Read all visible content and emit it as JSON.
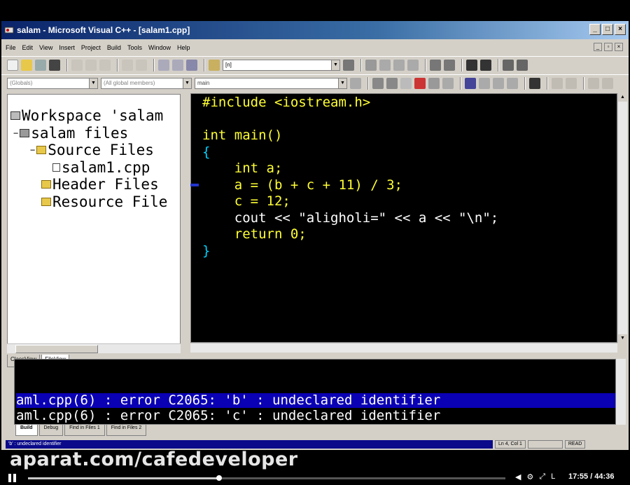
{
  "window": {
    "title": "salam - Microsoft Visual C++ - [salam1.cpp]",
    "buttons": [
      "_",
      "□",
      "×"
    ]
  },
  "menu": [
    "File",
    "Edit",
    "View",
    "Insert",
    "Project",
    "Build",
    "Tools",
    "Window",
    "Help"
  ],
  "toolbar": {
    "find_combo": "[n]",
    "class_combo": "(Globals)",
    "members_combo": "(All global members)",
    "function_combo": "main"
  },
  "workspace": {
    "tree": [
      {
        "label": "Workspace 'salam",
        "icon": "workspace-icon"
      },
      {
        "label": "salam files",
        "icon": "project-icon"
      },
      {
        "label": "Source Files",
        "icon": "folder-icon"
      },
      {
        "label": "salam1.cpp",
        "icon": "file-icon"
      },
      {
        "label": "Header Files",
        "icon": "folder-icon"
      },
      {
        "label": "Resource File",
        "icon": "folder-icon"
      }
    ],
    "tabs": [
      "ClassView",
      "FileView"
    ]
  },
  "code_lines": [
    "#include <iostream.h>",
    "",
    "int main()",
    "{",
    "    int a;",
    "    a = (b + c + 11) / 3;",
    "    c = 12;",
    "    cout << \"aligholi=\" << a << \"\\n\";",
    "    return 0;",
    "}"
  ],
  "output": {
    "lines": [
      "aml.cpp(6) : error C2065: 'b' : undeclared identifier",
      "aml.cpp(6) : error C2065: 'c' : undeclared identifier"
    ],
    "tabs": [
      "Build",
      "Debug",
      "Find in Files 1",
      "Find in Files 2"
    ]
  },
  "status": {
    "message": "'b' : undeclared identifier",
    "position": "Ln 4, Col 1",
    "read": "READ"
  },
  "video": {
    "watermark": "aparat.com/cafedeveloper",
    "time": "17:55 / 44:36",
    "progress": 0.4
  }
}
